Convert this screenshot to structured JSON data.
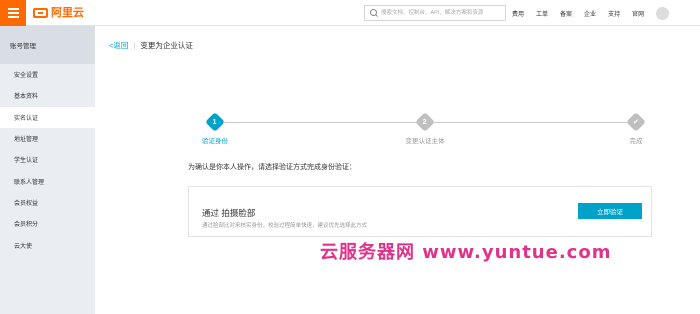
{
  "topbar": {
    "logo_text": "阿里云",
    "search_placeholder": "搜索文档、控制台、API、解决方案和资源",
    "nav": [
      "费用",
      "工单",
      "备案",
      "企业",
      "支持",
      "官网"
    ]
  },
  "sidebar": {
    "title": "账号管理",
    "items": [
      {
        "label": "安全设置",
        "active": false
      },
      {
        "label": "基本资料",
        "active": false
      },
      {
        "label": "实名认证",
        "active": true
      },
      {
        "label": "地址管理",
        "active": false
      },
      {
        "label": "学生认证",
        "active": false
      },
      {
        "label": "联系人管理",
        "active": false
      },
      {
        "label": "会员权益",
        "active": false
      },
      {
        "label": "会员积分",
        "active": false
      },
      {
        "label": "云大使",
        "active": false
      }
    ]
  },
  "breadcrumb": {
    "back": "<返回",
    "title": "变更为企业认证"
  },
  "steps": [
    {
      "number": "1",
      "label": "验证身份",
      "state": "active"
    },
    {
      "number": "2",
      "label": "变更认证主体",
      "state": "pending"
    },
    {
      "number": "✔",
      "label": "完成",
      "state": "pending"
    }
  ],
  "prompt": "为确认是你本人操作，请选择验证方式完成身份验证：",
  "method": {
    "title": "通过 拍摄脸部",
    "description": "通过脸部比对来核实身份，校验过程简单快速，建议优先选择此方式",
    "button_label": "立即验证"
  },
  "watermark": "云服务器网 www.yuntue.com",
  "colors": {
    "accent": "#00a2ca",
    "brand": "#ff6a00",
    "watermark": "#e0338a"
  }
}
